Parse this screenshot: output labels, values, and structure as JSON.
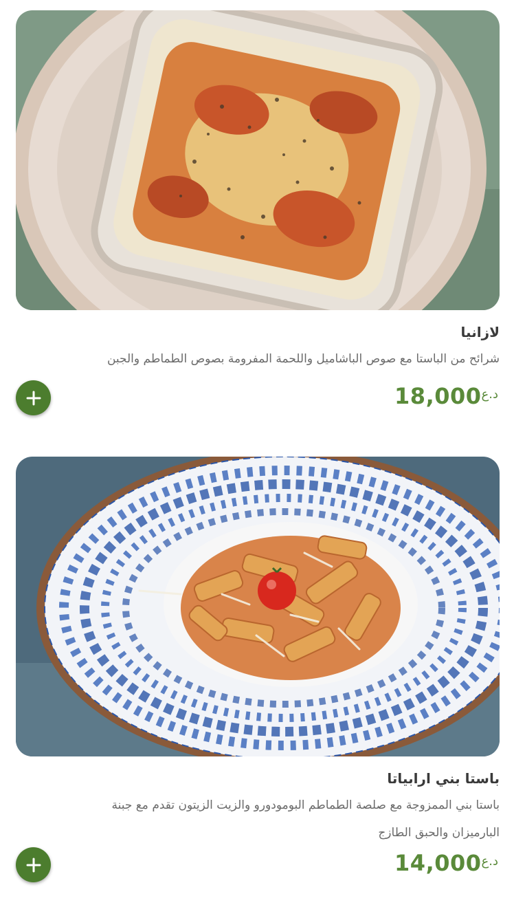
{
  "menu": {
    "items": [
      {
        "name": "لازانيا",
        "description": "شرائح من الباستا مع صوص الباشاميل واللحمة المفرومة بصوص الطماطم والجبن",
        "description_line2": "",
        "price": "18,000",
        "currency": "د.ع",
        "image": "lasagna-photo"
      },
      {
        "name": "باستا بني ارابياتا",
        "description": "باستا بني الممزوجة مع صلصة الطماطم البومودورو والزيت الزيتون تقدم مع جبنة",
        "description_line2": "البارميزان والحبق الطازج",
        "price": "14,000",
        "currency": "د.ع",
        "image": "penne-arrabbiata-photo"
      }
    ]
  },
  "colors": {
    "accent": "#4c7d2e",
    "price": "#5a8a3a",
    "title": "#3a3a3a",
    "description": "#6a6a6a"
  },
  "icons": {
    "add": "plus-icon"
  }
}
